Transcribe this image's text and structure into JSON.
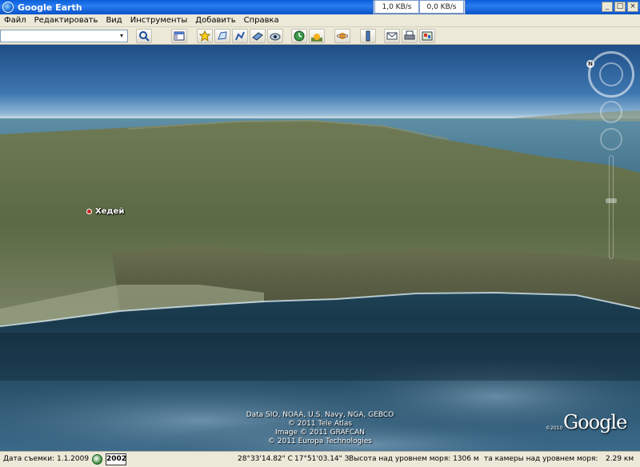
{
  "window": {
    "title": "Google Earth",
    "download_speed": "1,0 KB/s",
    "upload_speed": "0,0 KB/s",
    "minimize": "_",
    "maximize": "□",
    "close": "×"
  },
  "menu": {
    "items": [
      "Файл",
      "Редактировать",
      "Вид",
      "Инструменты",
      "Добавить",
      "Справка"
    ]
  },
  "toolbar": {
    "search_value": "",
    "combo_arrow": "▾"
  },
  "view": {
    "place_label": "Хедей",
    "north_label": "N",
    "credits": [
      "Data SIO, NOAA, U.S. Navy, NGA, GEBCO",
      "© 2011 Tele Atlas",
      "Image © 2011 GRAFCAN",
      "© 2011 Europa Technologies"
    ],
    "copyright_small": "©2010",
    "logo": "Google"
  },
  "status": {
    "imagery_date": "Дата съемки: 1.1.2009",
    "year_button": "2002",
    "latitude": "28°33'14.82\" С",
    "longitude": "17°51'03.14\" З",
    "elevation": "Высота над уровнем моря: 1306 м",
    "eye_alt": "та камеры над уровнем моря:",
    "eye_alt_value": "2.29 км"
  },
  "colors": {
    "titlebar": "#0a5fd8",
    "chrome": "#ece9d8",
    "sea": "#2f5f7a",
    "land": "#5a6a40"
  }
}
